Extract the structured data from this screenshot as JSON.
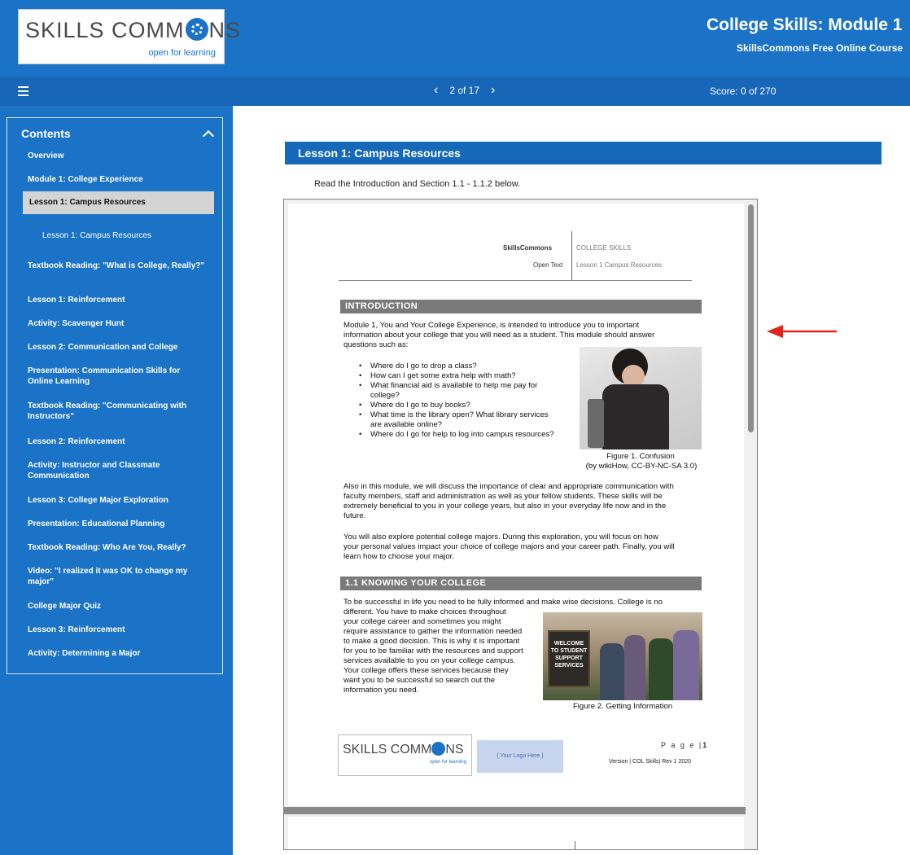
{
  "header": {
    "logo_word": "SKILLS COMM",
    "logo_word_tail": "NS",
    "logo_tagline": "open for learning",
    "title": "College Skills: Module 1",
    "subtitle": "SkillsCommons Free Online Course"
  },
  "navbar": {
    "page_indicator": "2 of 17",
    "prev_icon": "chevron-left",
    "next_icon": "chevron-right",
    "score": "Score: 0 of 270"
  },
  "sidebar": {
    "title": "Contents",
    "items": [
      "Overview",
      "Module 1: College Experience",
      "Lesson 1: Campus Resources",
      "Lesson 1: Campus Resources",
      "Textbook Reading: \"What is College, Really?\"",
      "Lesson 1: Reinforcement",
      "Activity: Scavenger Hunt",
      "Lesson 2: Communication and College",
      "Presentation: Communication Skills for Online Learning",
      "Textbook Reading: \"Communicating with Instructors\"",
      "Lesson 2: Reinforcement",
      "Activity: Instructor and Classmate Communication",
      "Lesson 3: College Major Exploration",
      "Presentation: Educational Planning",
      "Textbook Reading: Who Are You, Really?",
      "Video: \"I realized it was OK to change my major\"",
      "College Major Quiz",
      "Lesson 3: Reinforcement",
      "Activity: Determining a Major"
    ]
  },
  "main": {
    "lesson_title": "Lesson 1: Campus Resources",
    "instruction": "Read the Introduction and Section 1.1 - 1.1.2 below."
  },
  "document": {
    "hdr_org": "SkillsCommons",
    "hdr_course": "COLLEGE SKILLS",
    "hdr_type": "Open Text",
    "hdr_lesson": "Lesson 1 Campus Resources",
    "intro_heading": "INTRODUCTION",
    "intro_p1_l1": "Module 1, You and Your College Experience, is intended to introduce you to important",
    "intro_p1_l2": "information about your college that you will need as a student. This module should answer",
    "intro_p1_l3": "questions such as:",
    "bullets": [
      "Where do I go to drop a class?",
      "How can I get some extra help with math?",
      "What financial aid is available to help me pay for",
      "college?",
      "Where do I go to buy books?",
      "What time is the library open? What library services",
      "are available online?",
      "Where do I go for help to log into campus resources?"
    ],
    "fig1_caption_l1": "Figure 1. Confusion",
    "fig1_caption_l2": "(by wikiHow, CC-BY-NC-SA 3.0)",
    "intro_p2": [
      "Also in this module, we will discuss the importance of clear and appropriate communication with",
      "faculty members, staff and administration as well as your fellow students. These skills will be",
      "extremely beneficial to you in your college years, but also in your everyday life now and in the",
      "future."
    ],
    "intro_p3": [
      "You will also explore potential college majors. During this exploration, you will focus on how",
      "your personal values impact your choice of college majors and your career path. Finally, you will",
      "learn how to choose your major."
    ],
    "sec11_heading": "1.1 KNOWING YOUR COLLEGE",
    "sec11_p1": "To be successful in life you need to be fully informed and make wise decisions. College is no",
    "sec11_lines": [
      "different. You have to make choices throughout",
      "your college career and sometimes you might",
      "require assistance to gather the information needed",
      "to make a good decision. This is why it is important",
      "for you to be familiar with the resources and support",
      "services available to you on your college campus.",
      "Your college offers these services because they",
      "want you to be successful so search out the",
      "information you need."
    ],
    "fig2_board": "WELCOME TO STUDENT SUPPORT SERVICES",
    "fig2_caption": "Figure 2. Getting Information",
    "footer_logo_word": "SKILLS COMM",
    "footer_logo_word_tail": "NS",
    "footer_logo_tagline": "open for learning",
    "footer_your_logo": "{ Your Logo Here }",
    "footer_page_label": "P a g e |",
    "footer_page_number": "1",
    "footer_version": "Version | COL Skills| Rev 1 2020"
  },
  "colors": {
    "brand_blue": "#1b73c8",
    "annotation_arrow": "#e0251b"
  }
}
